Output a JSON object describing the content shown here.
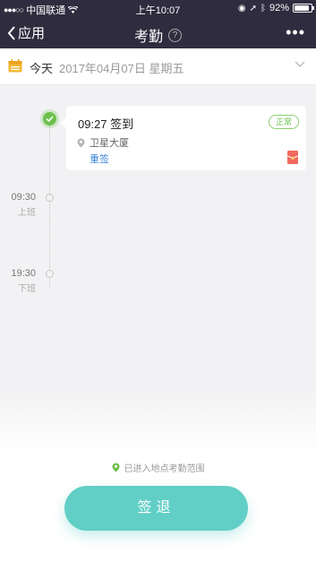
{
  "status_bar": {
    "carrier": "中国联通",
    "time": "上午10:07",
    "battery": "92%",
    "battery_level": 0.92
  },
  "nav": {
    "back_label": "应用",
    "title": "考勤",
    "help_glyph": "?",
    "more_glyph": "•••"
  },
  "date_bar": {
    "today_label": "今天",
    "date_text": "2017年04月07日 星期五"
  },
  "timeline": {
    "record": {
      "time_text": "09:27 签到",
      "status": "正常",
      "location": "卫星大厦",
      "resign_label": "重签"
    },
    "slots": [
      {
        "time": "09:30",
        "label": "上班"
      },
      {
        "time": "19:30",
        "label": "下班"
      }
    ]
  },
  "footer": {
    "range_tip": "已进入地点考勤范围",
    "checkout_label": "签退"
  },
  "colors": {
    "nav_bg": "#2f2c3f",
    "accent_green": "#6dc04b",
    "button_teal": "#61cfc6",
    "link_blue": "#3a84d8"
  },
  "icons": [
    "wifi-icon",
    "back-chevron-icon",
    "help-icon",
    "more-icon",
    "calendar-icon",
    "chevron-down-icon",
    "check-icon",
    "location-pin-icon",
    "gift-icon"
  ]
}
